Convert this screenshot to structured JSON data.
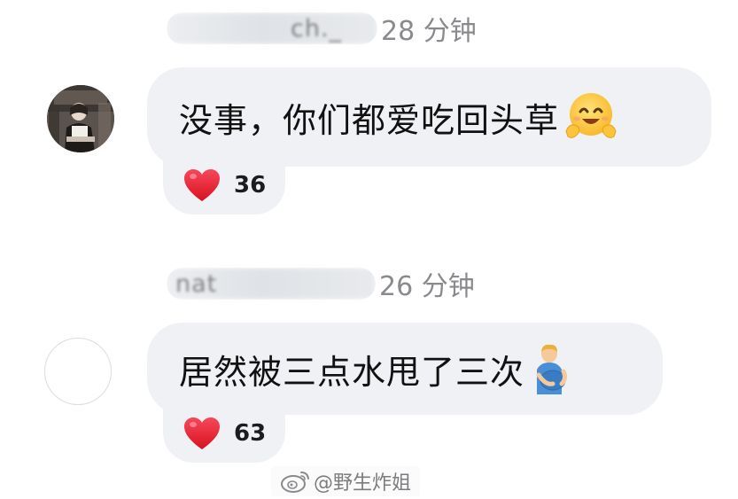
{
  "comments": [
    {
      "username": "ch._",
      "time": "28 分钟",
      "text": "没事，你们都爱吃回头草",
      "emoji": "hugging-face",
      "likes": "36",
      "avatar": "photo-avatar"
    },
    {
      "username": "nat",
      "time": "26 分钟",
      "text": "居然被三点水甩了三次",
      "emoji": "pregnant-man",
      "likes": "63",
      "avatar": "empty-avatar"
    }
  ],
  "watermark": {
    "text": "@野生炸姐",
    "icon": "weibo-icon"
  },
  "colors": {
    "bubble": "#f0f1f5",
    "heart": "#e8232f",
    "time": "#8a8a8e"
  }
}
